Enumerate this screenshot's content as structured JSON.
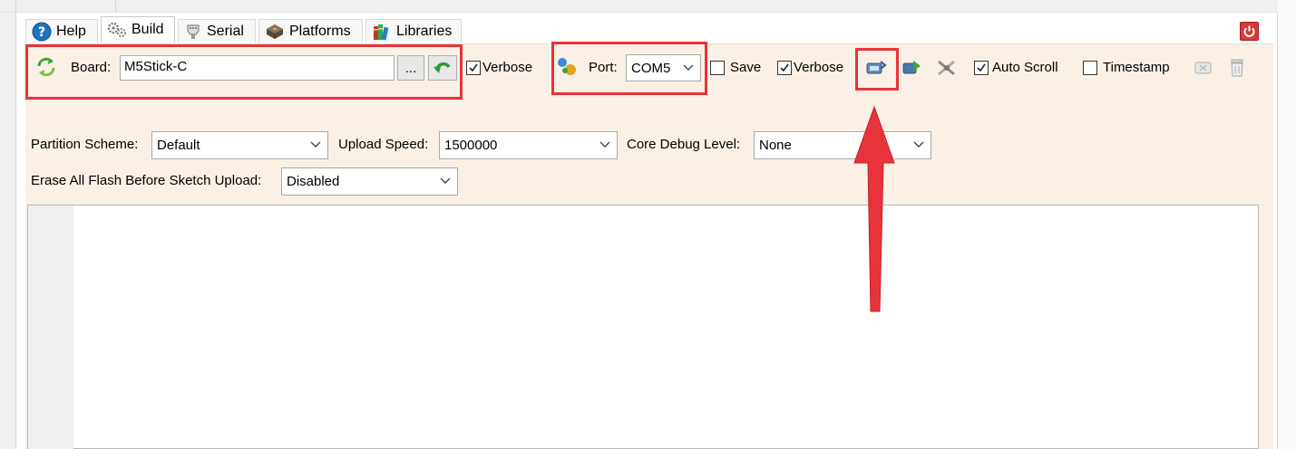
{
  "tabs": [
    {
      "label": "Help",
      "icon": "help-icon"
    },
    {
      "label": "Build",
      "icon": "gears-icon"
    },
    {
      "label": "Serial",
      "icon": "serial-connector-icon"
    },
    {
      "label": "Platforms",
      "icon": "chip-icon"
    },
    {
      "label": "Libraries",
      "icon": "books-icon"
    }
  ],
  "active_tab": "Build",
  "close_icon": "power-close-icon",
  "toolbar": {
    "board_label": "Board:",
    "board_value": "M5Stick-C",
    "browse_label": "...",
    "build_verbose_label": "Verbose",
    "build_verbose_checked": true,
    "port_label": "Port:",
    "port_value": "COM5",
    "save_label": "Save",
    "save_checked": false,
    "serial_verbose_label": "Verbose",
    "serial_verbose_checked": true,
    "auto_scroll_label": "Auto Scroll",
    "auto_scroll_checked": true,
    "timestamp_label": "Timestamp",
    "timestamp_checked": false
  },
  "options": {
    "partition_label": "Partition Scheme:",
    "partition_value": "Default",
    "upload_speed_label": "Upload Speed:",
    "upload_speed_value": "1500000",
    "debug_level_label": "Core Debug Level:",
    "debug_level_value": "None",
    "erase_label": "Erase All Flash Before Sketch Upload:",
    "erase_value": "Disabled"
  },
  "colors": {
    "panel_bg": "#faf0e6",
    "highlight": "#e8333a",
    "accent_blue": "#1e73be",
    "accent_green": "#3aa535"
  }
}
